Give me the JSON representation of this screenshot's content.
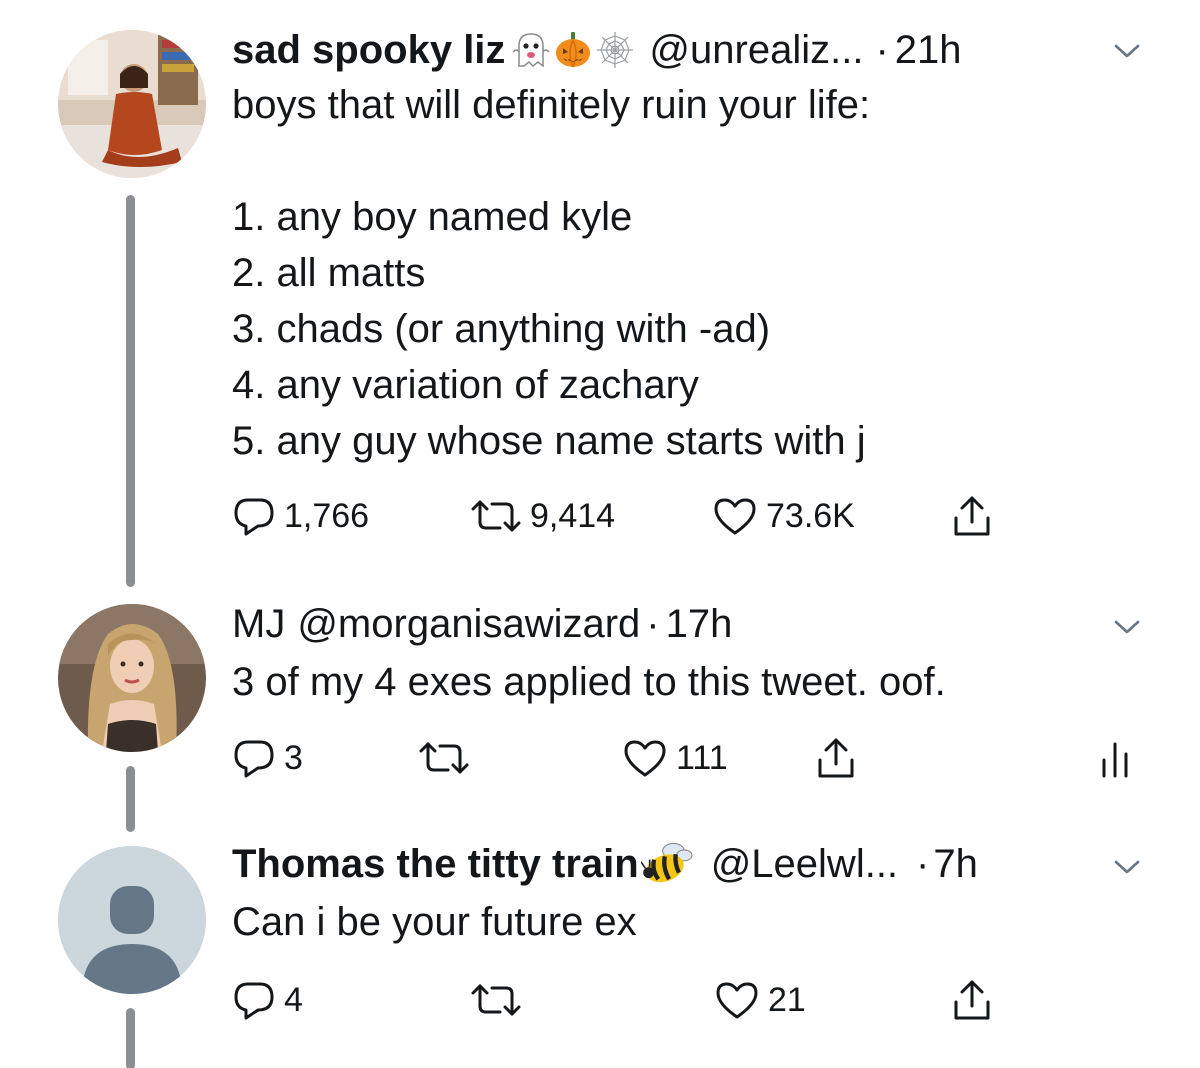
{
  "tweets": [
    {
      "display_name": "sad spooky liz",
      "emojis": [
        "ghost-emoji",
        "pumpkin-emoji",
        "spiderweb-emoji"
      ],
      "handle": "@unrealiz...",
      "separator": "·",
      "time": "21h",
      "text": "boys that will definitely ruin your life:\n\n1. any boy named kyle\n2. all matts\n3. chads (or anything with -ad)\n4. any variation of zachary\n5. any guy whose name starts with j",
      "replies": "1,766",
      "retweets": "9,414",
      "likes": "73.6K"
    },
    {
      "display_name": "MJ",
      "handle": "@morganisawizard",
      "separator": "·",
      "time": "17h",
      "text": "3 of my 4 exes applied to this tweet. oof.",
      "replies": "3",
      "retweets": "",
      "likes": "111"
    },
    {
      "display_name": "Thomas the titty train",
      "emojis": [
        "bee-emoji"
      ],
      "handle": "@Leelwl...",
      "separator": "·",
      "time": "7h",
      "text": "Can i be your future ex",
      "replies": "4",
      "retweets": "",
      "likes": "21"
    }
  ],
  "colors": {
    "text": "#14171a",
    "thread_line": "#8b8f94",
    "default_avatar_bg": "#ccd6dd",
    "default_avatar_fg": "#657786"
  }
}
